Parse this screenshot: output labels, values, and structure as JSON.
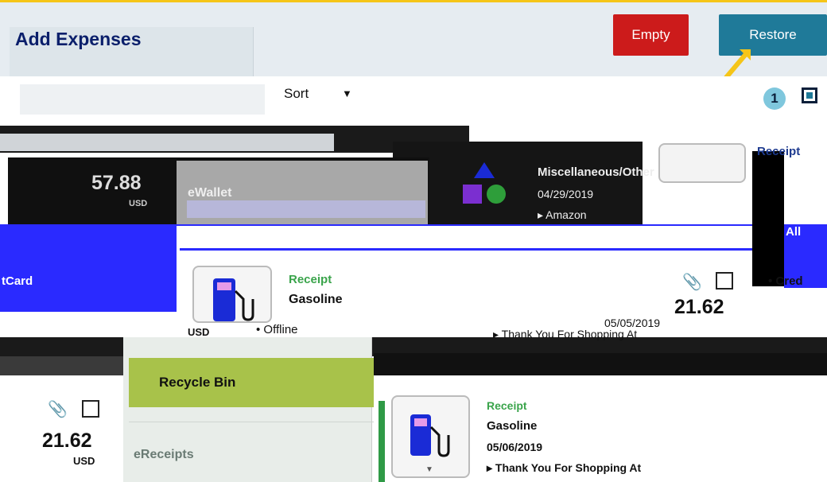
{
  "header": {
    "title": "Add Expenses",
    "empty_label": "Empty",
    "restore_label": "Restore"
  },
  "toolbar": {
    "sort_label": "Sort",
    "selected_count": "1"
  },
  "wallet": {
    "top_amount": "57.88",
    "top_currency": "USD",
    "ewallet_label": "eWallet",
    "misc_category": "Miscellaneous/Other",
    "misc_date": "04/29/2019",
    "misc_merchant": "Amazon",
    "receipt_label": "Receipt",
    "all_label": "All",
    "card_label": "tCard",
    "cred_label": "Cred"
  },
  "mid_expense": {
    "type": "Receipt",
    "category": "Gasoline",
    "amount": "21.62",
    "date": "05/05/2019",
    "currency": "USD",
    "status": "Offline",
    "merchant": "Thank You For Shopping At"
  },
  "nav": {
    "recycle_bin": "Recycle Bin",
    "ereceipts": "eReceipts"
  },
  "low_expense": {
    "amount": "21.62",
    "currency": "USD",
    "type": "Receipt",
    "category": "Gasoline",
    "date": "05/06/2019",
    "merchant": "Thank You For Shopping At"
  },
  "colors": {
    "empty_button": "#cc1b1b",
    "restore_button": "#1f7a99",
    "recycle_bin_active": "#a8c24a",
    "receipt_green": "#3aa44b"
  }
}
